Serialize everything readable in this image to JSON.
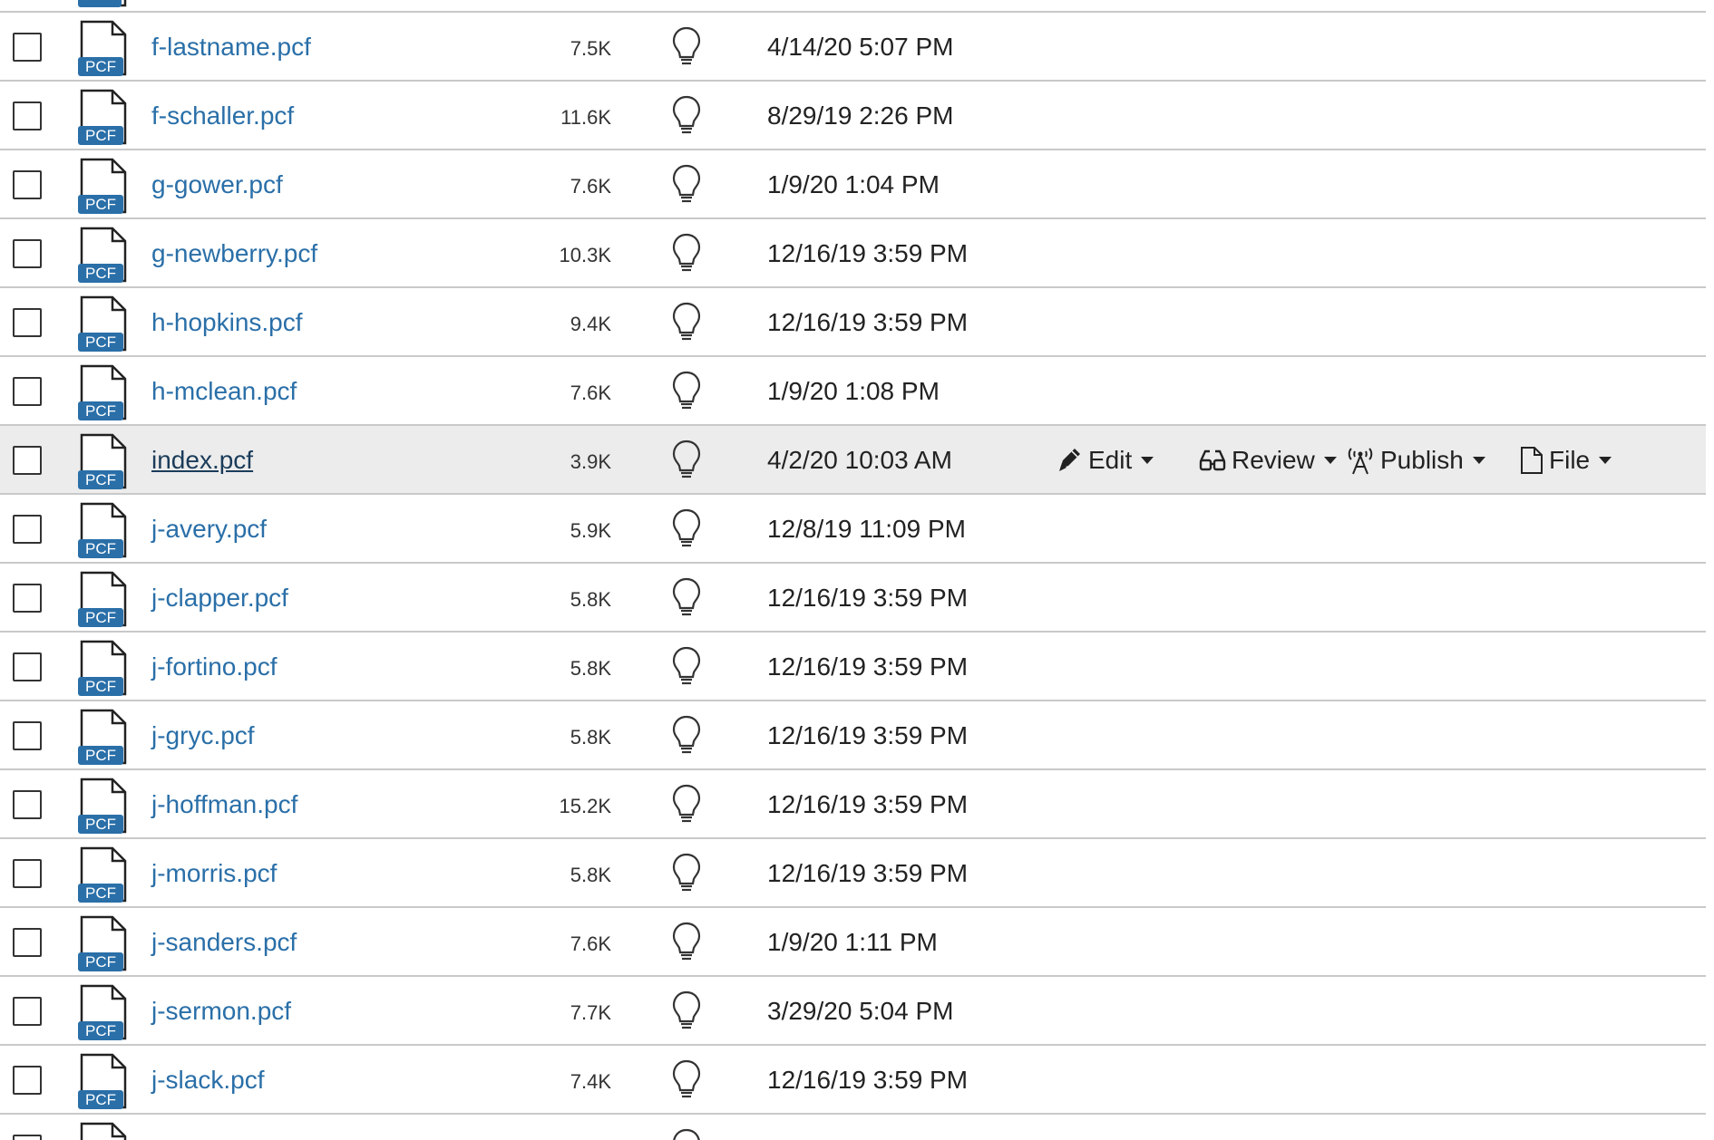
{
  "icons": {
    "file_type_badge": "PCF",
    "badge_color": "#2a6fa8",
    "link_color": "#2a6fa8",
    "hover_row_bg": "#ececec"
  },
  "actions": {
    "edit_label": "Edit",
    "review_label": "Review",
    "publish_label": "Publish",
    "file_label": "File"
  },
  "files": [
    {
      "name": "f-lastname.pcf",
      "size": "7.5K",
      "modified": "4/14/20 5:07 PM"
    },
    {
      "name": "f-schaller.pcf",
      "size": "11.6K",
      "modified": "8/29/19 2:26 PM"
    },
    {
      "name": "g-gower.pcf",
      "size": "7.6K",
      "modified": "1/9/20 1:04 PM"
    },
    {
      "name": "g-newberry.pcf",
      "size": "10.3K",
      "modified": "12/16/19 3:59 PM"
    },
    {
      "name": "h-hopkins.pcf",
      "size": "9.4K",
      "modified": "12/16/19 3:59 PM"
    },
    {
      "name": "h-mclean.pcf",
      "size": "7.6K",
      "modified": "1/9/20 1:08 PM"
    },
    {
      "name": "index.pcf",
      "size": "3.9K",
      "modified": "4/2/20 10:03 AM"
    },
    {
      "name": "j-avery.pcf",
      "size": "5.9K",
      "modified": "12/8/19 11:09 PM"
    },
    {
      "name": "j-clapper.pcf",
      "size": "5.8K",
      "modified": "12/16/19 3:59 PM"
    },
    {
      "name": "j-fortino.pcf",
      "size": "5.8K",
      "modified": "12/16/19 3:59 PM"
    },
    {
      "name": "j-gryc.pcf",
      "size": "5.8K",
      "modified": "12/16/19 3:59 PM"
    },
    {
      "name": "j-hoffman.pcf",
      "size": "15.2K",
      "modified": "12/16/19 3:59 PM"
    },
    {
      "name": "j-morris.pcf",
      "size": "5.8K",
      "modified": "12/16/19 3:59 PM"
    },
    {
      "name": "j-sanders.pcf",
      "size": "7.6K",
      "modified": "1/9/20 1:11 PM"
    },
    {
      "name": "j-sermon.pcf",
      "size": "7.7K",
      "modified": "3/29/20 5:04 PM"
    },
    {
      "name": "j-slack.pcf",
      "size": "7.4K",
      "modified": "12/16/19 3:59 PM"
    }
  ],
  "hover_index": 6
}
